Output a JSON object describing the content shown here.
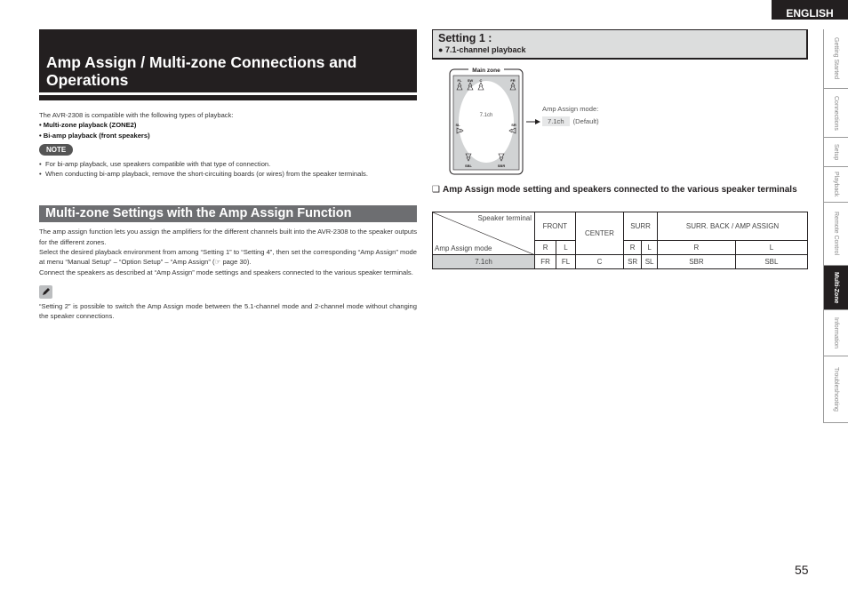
{
  "header": {
    "language": "ENGLISH"
  },
  "left": {
    "title_line1": "Amp Assign / Multi-zone Connections and",
    "title_line2": "Operations",
    "intro": "The AVR-2308 is compatible with the following types of playback:",
    "playback_types": [
      "• Multi-zone playback (ZONE2)",
      "• Bi-amp playback (front speakers)"
    ],
    "note_label": "NOTE",
    "notes": [
      "For bi-amp playback, use speakers compatible with that type of connection.",
      "When conducting bi-amp playback, remove the short-circuiting boards (or wires) from the speaker terminals."
    ],
    "section_title": "Multi-zone Settings with the Amp Assign Function",
    "section_paragraphs": [
      "The amp assign function lets you assign the amplifiers for the different channels built into the AVR-2308 to the speaker outputs for the different zones.",
      "Select the desired playback environment from among “Setting 1” to “Setting 4”, then set the corresponding “Amp Assign” mode at menu “Manual Setup” – “Option Setup” – “Amp Assign” (☞ page 30).",
      "Connect the speakers as described at “Amp Assign” mode settings and speakers connected to the various speaker terminals."
    ],
    "tip": "“Setting 2” is possible to switch the Amp Assign mode between the 5.1-channel mode and 2-channel mode without changing the speaker connections."
  },
  "right": {
    "setting_title": "Setting 1 :",
    "setting_sub": "7.1-channel playback",
    "diagram": {
      "zone_label": "Main zone",
      "center_label": "7.1ch",
      "speakers": [
        "FL",
        "SW",
        "C",
        "FR",
        "SL",
        "SR",
        "SBL",
        "SBR"
      ]
    },
    "amp_assign_label": "Amp Assign mode:",
    "amp_assign_value": "7.1ch",
    "amp_assign_default": "(Default)",
    "table_heading": "Amp Assign mode setting and speakers connected to the various speaker terminals",
    "table": {
      "corner_top": "Speaker terminal",
      "corner_bottom": "Amp Assign mode",
      "groups": [
        "FRONT",
        "CENTER",
        "SURR",
        "SURR. BACK / AMP ASSIGN"
      ],
      "sub": [
        "R",
        "L",
        "R",
        "L",
        "R",
        "L"
      ],
      "rows": [
        {
          "mode": "7.1ch",
          "cells": [
            "FR",
            "FL",
            "C",
            "SR",
            "SL",
            "SBR",
            "SBL"
          ]
        }
      ]
    }
  },
  "side_tabs": [
    {
      "label": "Getting Started",
      "active": false
    },
    {
      "label": "Connections",
      "active": false
    },
    {
      "label": "Setup",
      "active": false
    },
    {
      "label": "Playback",
      "active": false
    },
    {
      "label": "Remote Control",
      "active": false
    },
    {
      "label": "Multi-Zone",
      "active": true
    },
    {
      "label": "Information",
      "active": false
    },
    {
      "label": "Troubleshooting",
      "active": false
    }
  ],
  "page_number": "55"
}
